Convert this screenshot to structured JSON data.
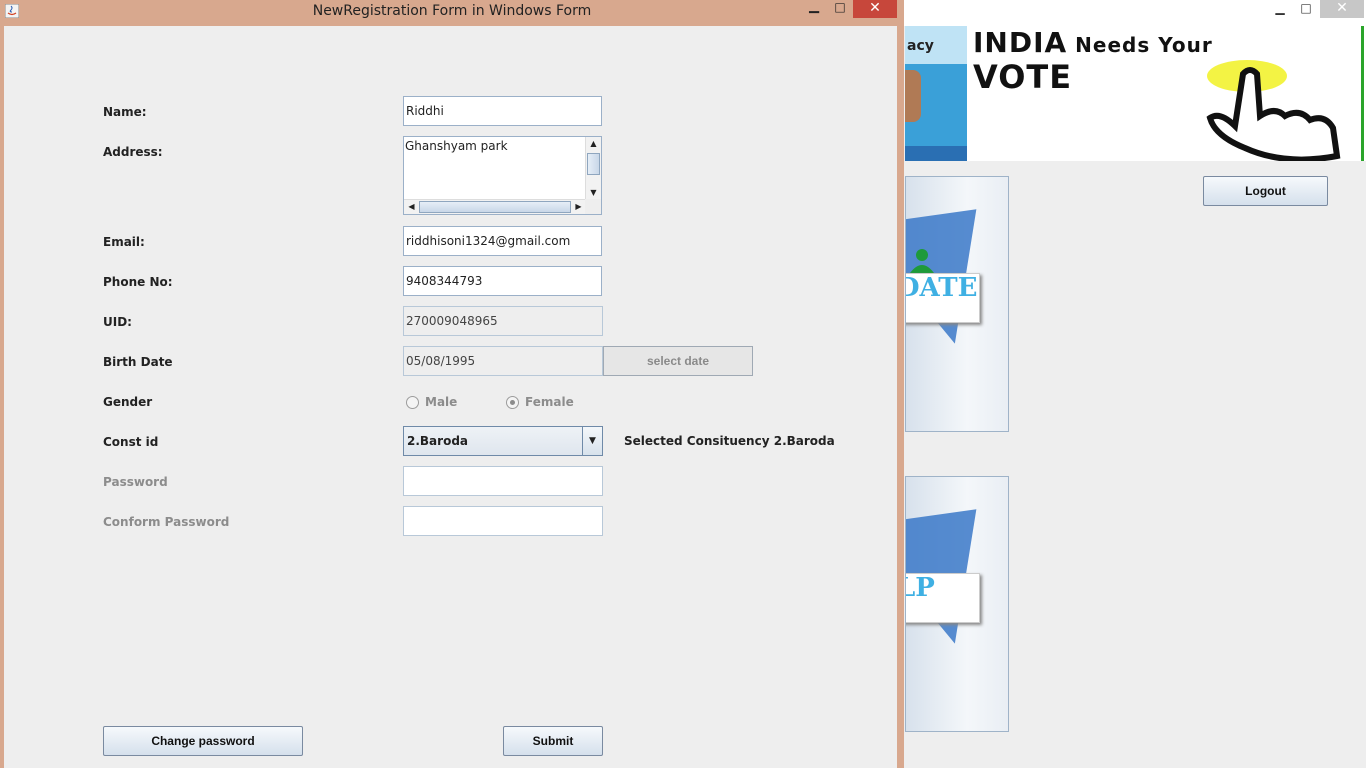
{
  "dialog": {
    "title": "NewRegistration Form in Windows Form",
    "minimize": "▁",
    "maximize": "□",
    "close": "✕"
  },
  "background_window": {
    "banner_left_text": "acy",
    "banner_line1_big": "INDIA",
    "banner_line1_small": " Needs Your",
    "banner_line2": "VOTE",
    "tile1_label": "DATE",
    "tile2_label": "LP",
    "logout_label": "Logout",
    "minimize": "▁",
    "maximize": "□",
    "close": "✕"
  },
  "form": {
    "name": {
      "label": "Name:",
      "value": "Riddhi"
    },
    "address": {
      "label": "Address:",
      "value": "Ghanshyam park"
    },
    "email": {
      "label": "Email:",
      "value": "riddhisoni1324@gmail.com"
    },
    "phone": {
      "label": "Phone No:",
      "value": "9408344793"
    },
    "uid": {
      "label": "UID:",
      "value": "270009048965"
    },
    "birth_date": {
      "label": "Birth Date",
      "value": "05/08/1995",
      "button": "select date"
    },
    "gender": {
      "label": "Gender",
      "options": [
        "Male",
        "Female"
      ],
      "selected": "Female"
    },
    "const_id": {
      "label": "Const id",
      "value": "2.Baroda",
      "selected_text": "Selected Consituency 2.Baroda"
    },
    "password": {
      "label": "Password",
      "value": ""
    },
    "confirm_password": {
      "label": "Conform Password",
      "value": ""
    }
  },
  "buttons": {
    "change_password": "Change password",
    "submit": "Submit"
  },
  "colors": {
    "title_bar": "#d8a88e",
    "close_button": "#c7473b",
    "window_bg": "#eeeeee",
    "field_border": "#9bb0c8",
    "banner_accent": "#2aa52a"
  }
}
